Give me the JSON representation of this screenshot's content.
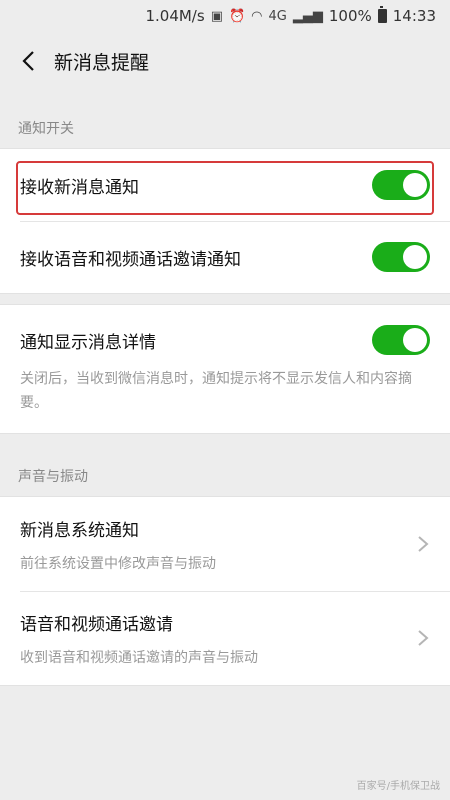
{
  "status_bar": {
    "speed": "1.04M/s",
    "network": "4G",
    "battery": "100%",
    "time": "14:33"
  },
  "nav": {
    "title": "新消息提醒"
  },
  "sections": {
    "notify_switch": {
      "header": "通知开关",
      "items": [
        {
          "label": "接收新消息通知",
          "enabled": true
        },
        {
          "label": "接收语音和视频通话邀请通知",
          "enabled": true
        }
      ]
    },
    "detail": {
      "label": "通知显示消息详情",
      "enabled": true,
      "description": "关闭后，当收到微信消息时，通知提示将不显示发信人和内容摘要。"
    },
    "sound": {
      "header": "声音与振动",
      "items": [
        {
          "label": "新消息系统通知",
          "description": "前往系统设置中修改声音与振动"
        },
        {
          "label": "语音和视频通话邀请",
          "description": "收到语音和视频通话邀请的声音与振动"
        }
      ]
    }
  },
  "colors": {
    "toggle_on": "#1aad19",
    "highlight": "#d63a3a",
    "background": "#ededed"
  },
  "watermark": "百家号/手机保卫战"
}
